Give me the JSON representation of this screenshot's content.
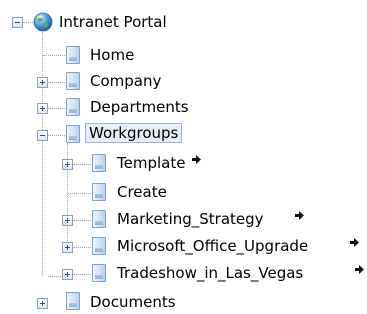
{
  "tree": {
    "root": {
      "label": "Intranet Portal",
      "icon": "globe-icon",
      "expanded": true
    },
    "items": [
      {
        "label": "Home",
        "icon": "page-icon"
      },
      {
        "label": "Company",
        "icon": "page-icon",
        "expanded": false
      },
      {
        "label": "Departments",
        "icon": "page-icon",
        "expanded": false
      },
      {
        "label": "Workgroups",
        "icon": "page-icon",
        "expanded": true,
        "selected": true,
        "children": [
          {
            "label": "Template",
            "icon": "page-icon",
            "expanded": false,
            "has_arrow": true
          },
          {
            "label": "Create",
            "icon": "page-icon"
          },
          {
            "label": "Marketing_Strategy",
            "icon": "page-icon",
            "expanded": false,
            "has_arrow": true
          },
          {
            "label": "Microsoft_Office_Upgrade",
            "icon": "page-icon",
            "expanded": false,
            "has_arrow": true
          },
          {
            "label": "Tradeshow_in_Las_Vegas",
            "icon": "page-icon",
            "expanded": false,
            "has_arrow": true
          }
        ]
      },
      {
        "label": "Documents",
        "icon": "page-icon",
        "expanded": false
      }
    ]
  },
  "colors": {
    "selection_border": "#9bb5d8",
    "selection_bg": "#e8eef8",
    "tree_lines": "#a8a8a8",
    "arrow": "#111111"
  }
}
